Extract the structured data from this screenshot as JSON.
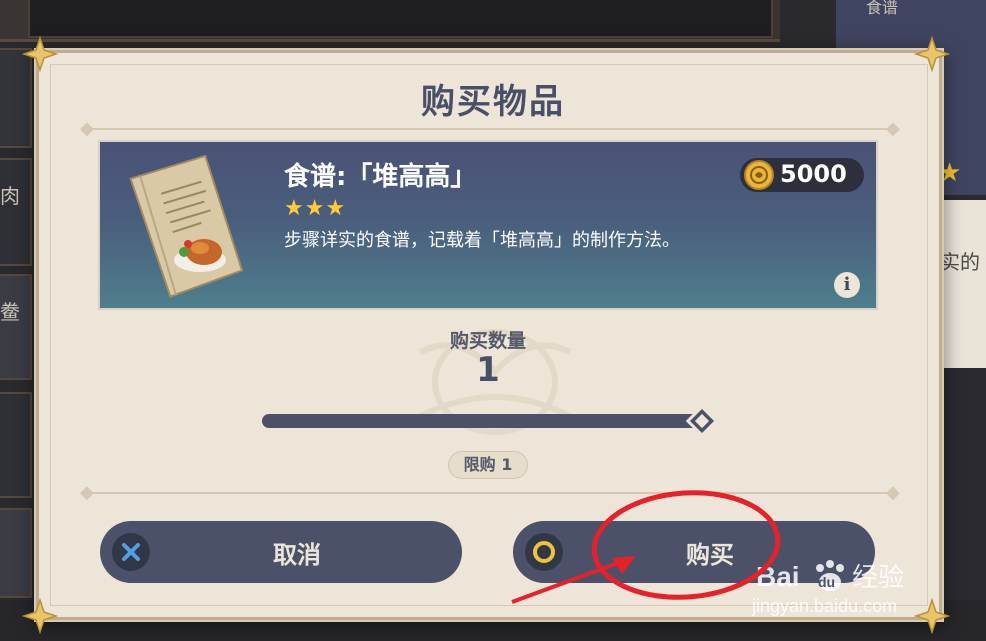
{
  "background": {
    "left_tab_glyphs": [
      "肉",
      "鲞"
    ],
    "right_panel_label": "食谱",
    "right_panel_text": "实的"
  },
  "dialog": {
    "title": "购买物品",
    "item": {
      "name": "食谱:「堆高高」",
      "rarity_stars": "★★★",
      "rarity_count": 3,
      "description": "步骤详实的食谱，记载着「堆高高」的制作方法。",
      "price": "5000",
      "currency_icon": "mora-coin-icon",
      "info_icon": "i"
    },
    "quantity": {
      "label": "购买数量",
      "value": "1",
      "slider_fraction": 1.0,
      "limit_label": "限购 1"
    },
    "buttons": {
      "cancel_label": "取消",
      "cancel_icon": "x-icon",
      "buy_label": "购买",
      "buy_icon": "circle-icon"
    }
  },
  "colors": {
    "dialog_bg": "#ece5d8",
    "title_text": "#484f66",
    "button_bg": "#4a5168",
    "star": "#ffcc33",
    "annotation": "#e8202a",
    "cancel_icon": "#4aa3e0",
    "buy_icon": "#f0c23a"
  },
  "watermark": {
    "logo_text": "Bai du 经验",
    "url": "jingyan.baidu.com"
  }
}
